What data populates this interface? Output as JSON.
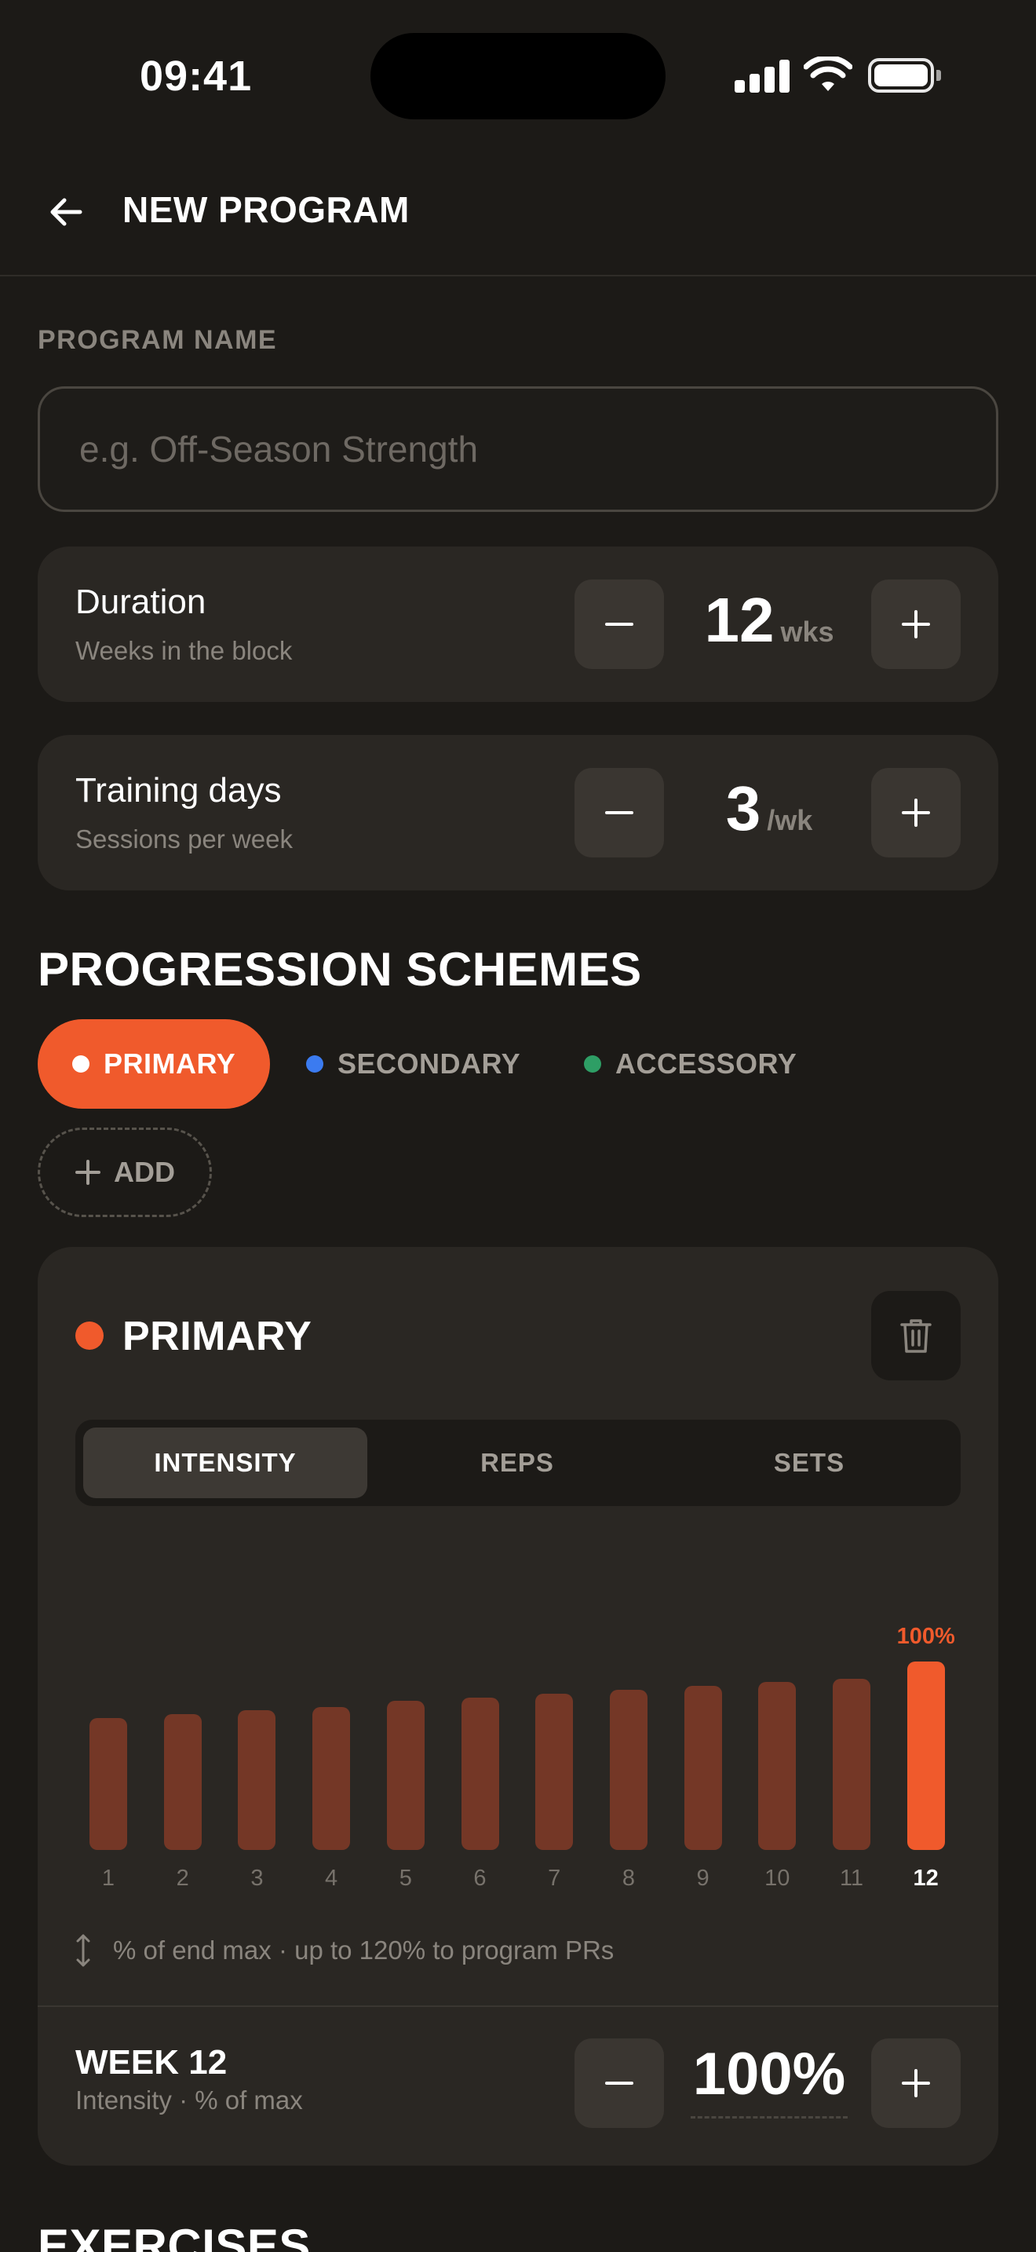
{
  "status_bar": {
    "time": "09:41"
  },
  "header": {
    "title": "NEW PROGRAM"
  },
  "program_name": {
    "label": "PROGRAM NAME",
    "placeholder": "e.g. Off-Season Strength",
    "value": ""
  },
  "duration": {
    "title": "Duration",
    "subtitle": "Weeks in the block",
    "value": "12",
    "unit": "wks"
  },
  "training_days": {
    "title": "Training days",
    "subtitle": "Sessions per week",
    "value": "3",
    "unit": "/wk"
  },
  "progression": {
    "heading": "PROGRESSION SCHEMES",
    "chips": [
      {
        "label": "PRIMARY",
        "color": "#f05a2c",
        "active": true
      },
      {
        "label": "SECONDARY",
        "color": "#3b7bf0",
        "active": false
      },
      {
        "label": "ACCESSORY",
        "color": "#2e9e65",
        "active": false
      }
    ],
    "add_label": "ADD"
  },
  "scheme": {
    "title": "PRIMARY",
    "color": "#f05a2c",
    "tabs": [
      "INTENSITY",
      "REPS",
      "SETS"
    ],
    "active_tab": "INTENSITY",
    "hint": "% of end max · up to 120% to program PRs",
    "week_title": "WEEK 12",
    "week_subtitle": "Intensity · % of max",
    "week_value": "100%"
  },
  "chart_data": {
    "type": "bar",
    "categories": [
      "1",
      "2",
      "3",
      "4",
      "5",
      "6",
      "7",
      "8",
      "9",
      "10",
      "11",
      "12"
    ],
    "values": [
      70,
      72,
      74,
      76,
      79,
      81,
      83,
      85,
      87,
      89,
      91,
      100
    ],
    "highlight_index": 11,
    "highlight_label": "100%",
    "ylim": [
      0,
      120
    ]
  },
  "exercises": {
    "heading": "EXERCISES"
  }
}
